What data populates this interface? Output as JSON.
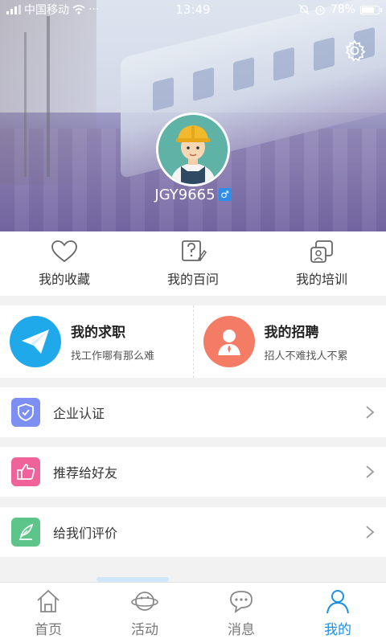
{
  "status": {
    "carrier": "中国移动",
    "dots": "···",
    "time": "13:49",
    "battery_label": "78%",
    "battery_fraction": 0.78
  },
  "profile": {
    "username": "JGY9665",
    "gender_symbol": "♂"
  },
  "quick": [
    {
      "label": "我的收藏",
      "icon": "heart-icon"
    },
    {
      "label": "我的百问",
      "icon": "question-doc-icon"
    },
    {
      "label": "我的培训",
      "icon": "training-icon"
    }
  ],
  "jobs": [
    {
      "title": "我的求职",
      "subtitle": "找工作哪有那么难",
      "icon": "paper-plane-icon",
      "color": "#1fa9ea"
    },
    {
      "title": "我的招聘",
      "subtitle": "招人不难找人不累",
      "icon": "person-icon",
      "color": "#f47c64"
    }
  ],
  "menu": [
    {
      "label": "企业认证",
      "icon": "shield-icon",
      "color": "#7d8ff2"
    },
    {
      "label": "推荐给好友",
      "icon": "thumbs-up-icon",
      "color": "#f0629a"
    },
    {
      "label": "给我们评价",
      "icon": "pen-icon",
      "color": "#5ec58a"
    }
  ],
  "tabs": [
    {
      "label": "首页",
      "icon": "home-icon",
      "active": false
    },
    {
      "label": "活动",
      "icon": "planet-icon",
      "active": false
    },
    {
      "label": "消息",
      "icon": "chat-icon",
      "active": false
    },
    {
      "label": "我的",
      "icon": "user-icon",
      "active": true
    }
  ],
  "colors": {
    "accent": "#1c8fe6"
  }
}
